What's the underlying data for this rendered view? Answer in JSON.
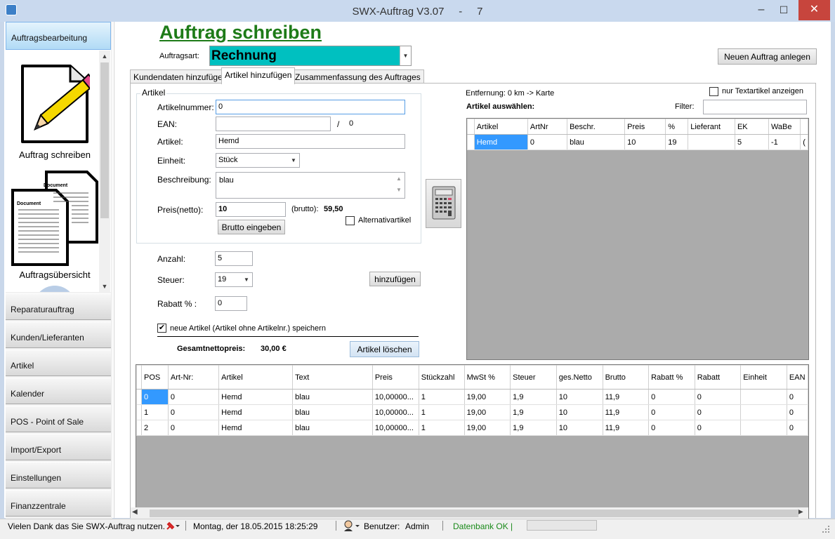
{
  "window": {
    "title": "SWX-Auftrag V3.07     -     7",
    "minimize": "–",
    "maximize": "☐",
    "close": "✕"
  },
  "sidebar": {
    "active": "Auftragsbearbeitung",
    "panel_items": [
      {
        "label": "Auftrag schreiben",
        "icon": "pencil-document-icon"
      },
      {
        "label": "Auftragsübersicht",
        "icon": "documents-icon"
      }
    ],
    "doc_icon_text": "Document",
    "buttons": [
      "Reparaturauftrag",
      "Kunden/Lieferanten",
      "Artikel",
      "Kalender",
      "POS - Point of Sale",
      "Import/Export",
      "Einstellungen",
      "Finanzzentrale"
    ]
  },
  "page": {
    "title": "Auftrag schreiben",
    "ordertype_label": "Auftragsart:",
    "ordertype_value": "Rechnung",
    "new_order_button": "Neuen Auftrag anlegen"
  },
  "tabs": [
    "Kundendaten hinzufügen",
    "Artikel hinzufügen",
    "Zusammenfassung des Auftrages"
  ],
  "form": {
    "group_label": "Artikel",
    "artnr_label": "Artikelnummer:",
    "artnr_value": "0",
    "ean_label": "EAN:",
    "ean_value": "",
    "ean_sep": "/",
    "ean_count": "0",
    "artikel_label": "Artikel:",
    "artikel_value": "Hemd",
    "einheit_label": "Einheit:",
    "einheit_value": "Stück",
    "beschreibung_label": "Beschreibung:",
    "beschreibung_value": "blau",
    "preis_label": "Preis(netto):",
    "preis_value": "10",
    "brutto_label": "(brutto):",
    "brutto_value": "59,50",
    "brutto_button": "Brutto eingeben",
    "alternativ_label": "Alternativartikel",
    "anzahl_label": "Anzahl:",
    "anzahl_value": "5",
    "steuer_label": "Steuer:",
    "steuer_value": "19",
    "add_button": "hinzufügen",
    "rabatt_label": "Rabatt % :",
    "rabatt_value": "0",
    "save_new_label": "neue Artikel (Artikel ohne Artikelnr.) speichern",
    "total_label": "Gesamtnettopreis:",
    "total_value": "30,00 €",
    "delete_button": "Artikel löschen"
  },
  "right": {
    "entfernung": "Entfernung:  0 km -> Karte",
    "nur_text_label": "nur Textartikel anzeigen",
    "select_label": "Artikel auswählen:",
    "filter_label": "Filter:",
    "filter_value": ""
  },
  "article_grid": {
    "columns": [
      "Artikel",
      "ArtNr",
      "Beschr.",
      "Preis",
      "%",
      "Lieferant",
      "EK",
      "WaBe",
      ""
    ],
    "rows": [
      [
        "Hemd",
        "0",
        "blau",
        "10",
        "19",
        "",
        "5",
        "-1",
        "("
      ]
    ]
  },
  "order_grid": {
    "columns": [
      "POS",
      "Art-Nr:",
      "Artikel",
      "Text",
      "Preis",
      "Stückzahl",
      "MwSt %",
      "Steuer",
      "ges.Netto",
      "Brutto",
      "Rabatt %",
      "Rabatt",
      "Einheit",
      "EAN"
    ],
    "rows": [
      [
        "0",
        "0",
        "Hemd",
        "blau",
        "10,00000...",
        "1",
        "19,00",
        "1,9",
        "10",
        "11,9",
        "0",
        "0",
        "",
        "0"
      ],
      [
        "1",
        "0",
        "Hemd",
        "blau",
        "10,00000...",
        "1",
        "19,00",
        "1,9",
        "10",
        "11,9",
        "0",
        "0",
        "",
        "0"
      ],
      [
        "2",
        "0",
        "Hemd",
        "blau",
        "10,00000...",
        "1",
        "19,00",
        "1,9",
        "10",
        "11,9",
        "0",
        "0",
        "",
        "0"
      ]
    ]
  },
  "status": {
    "message": "Vielen Dank das Sie SWX-Auftrag nutzen.",
    "datetime": "Montag, der 18.05.2015 18:25:29",
    "user_label": "Benutzer:",
    "user_value": "Admin",
    "db": "Datenbank OK"
  },
  "colors": {
    "title_green": "#1e7b18",
    "ordertype_bg": "#00c0c0",
    "selection": "#3399ff",
    "db_ok": "#1a8a1a"
  }
}
